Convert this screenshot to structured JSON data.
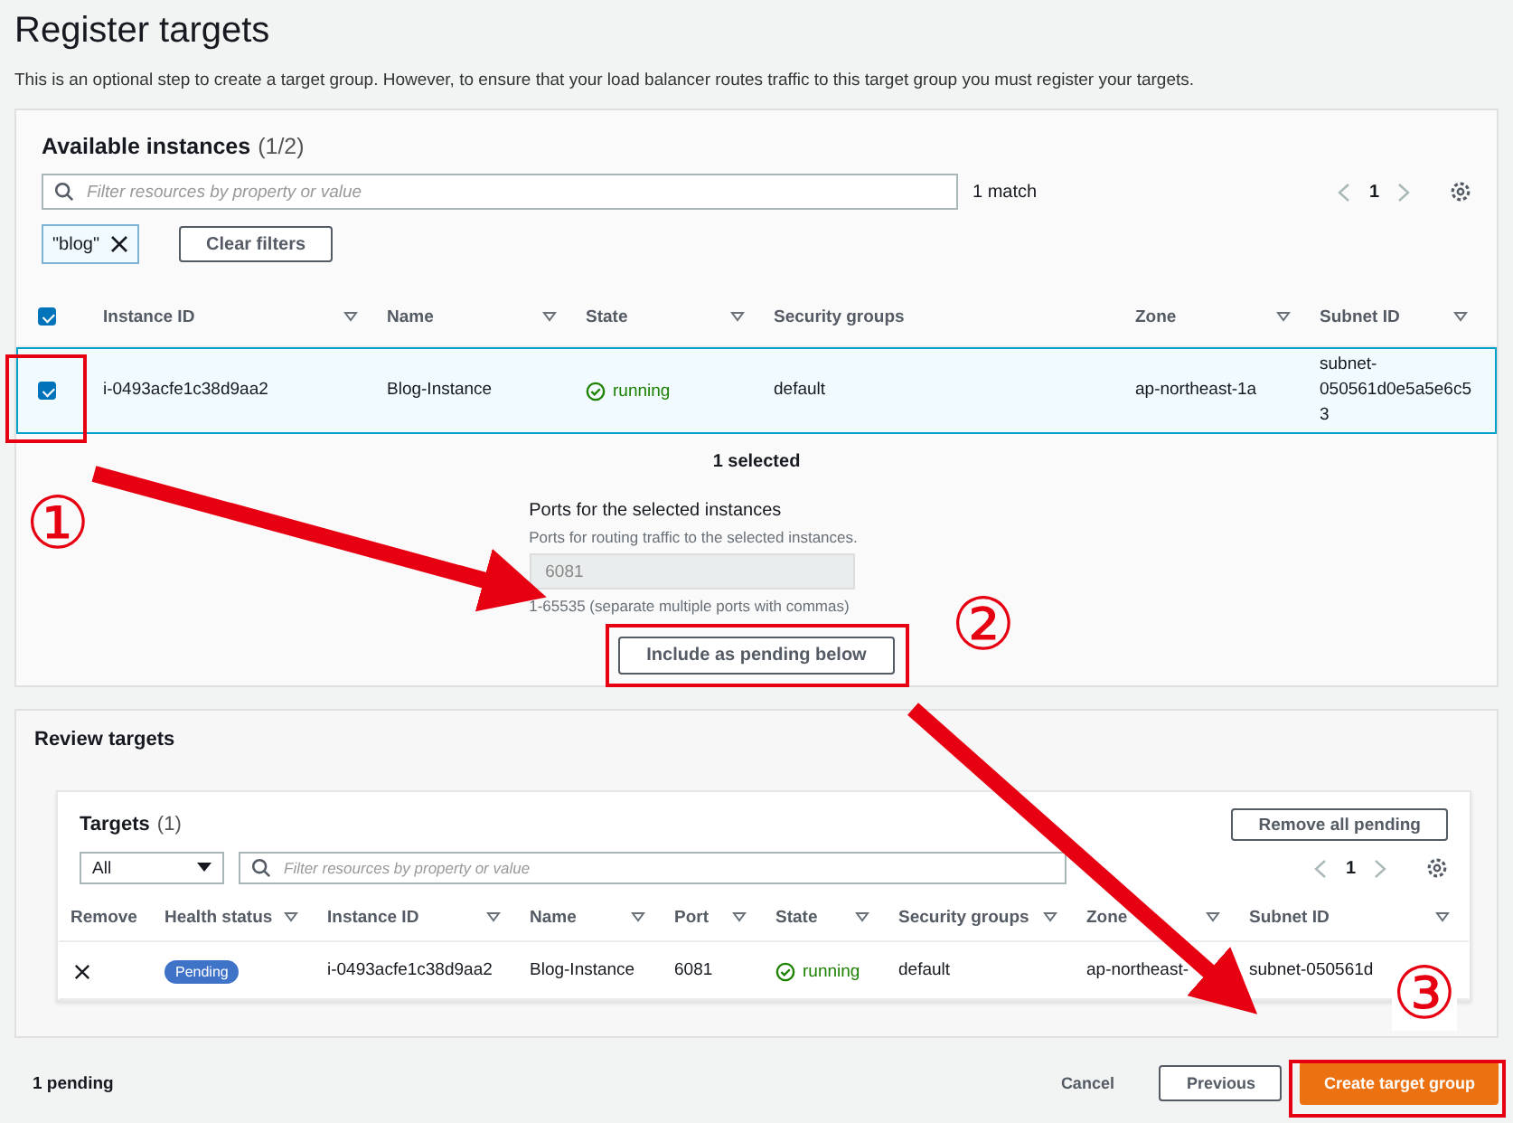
{
  "page": {
    "title": "Register targets",
    "description": "This is an optional step to create a target group. However, to ensure that your load balancer routes traffic to this target group you must register your targets."
  },
  "available": {
    "title": "Available instances",
    "count": "(1/2)",
    "search": {
      "placeholder": "Filter resources by property or value"
    },
    "match": "1 match",
    "page": "1",
    "filter_token": "\"blog\"",
    "clear_button": "Clear filters",
    "header_checked": true,
    "columns": [
      {
        "label": "Instance ID",
        "sortable": true
      },
      {
        "label": "Name",
        "sortable": true
      },
      {
        "label": "State",
        "sortable": true
      },
      {
        "label": "Security groups"
      },
      {
        "label": "Zone",
        "sortable": true
      },
      {
        "label": "Subnet ID",
        "sortable": true
      }
    ],
    "rows": [
      {
        "selected": true,
        "cells": [
          {
            "kind": "text",
            "text": "i-0493acfe1c38d9aa2"
          },
          {
            "kind": "text",
            "text": "Blog-Instance"
          },
          {
            "kind": "status",
            "text": "running"
          },
          {
            "kind": "text",
            "text": "default"
          },
          {
            "kind": "text",
            "text": "ap-northeast-1a"
          },
          {
            "kind": "text",
            "text": "subnet-050561d0e5a5e6c53"
          }
        ]
      }
    ],
    "selected_summary": "1 selected",
    "ports": {
      "label": "Ports for the selected instances",
      "hint": "Ports for routing traffic to the selected instances.",
      "value": "6081",
      "constraint": "1-65535 (separate multiple ports with commas)"
    },
    "include_button": "Include as pending below"
  },
  "review": {
    "title": "Review targets",
    "targets": {
      "title": "Targets",
      "count": "(1)",
      "remove_all_button": "Remove all pending",
      "filter_select": "All",
      "search": {
        "placeholder": "Filter resources by property or value"
      },
      "page": "1",
      "columns": [
        {
          "label": "Remove"
        },
        {
          "label": "Health status",
          "sortable": true
        },
        {
          "label": "Instance ID",
          "sortable": true
        },
        {
          "label": "Name",
          "sortable": true
        },
        {
          "label": "Port",
          "sortable": true
        },
        {
          "label": "State",
          "sortable": true
        },
        {
          "label": "Security groups",
          "sortable": true
        },
        {
          "label": "Zone",
          "sortable": true
        },
        {
          "label": "Subnet ID",
          "sortable": true
        }
      ],
      "rows": [
        {
          "cells": [
            {
              "kind": "remove"
            },
            {
              "kind": "badge",
              "text": "Pending"
            },
            {
              "kind": "text",
              "text": "i-0493acfe1c38d9aa2"
            },
            {
              "kind": "text",
              "text": "Blog-Instance"
            },
            {
              "kind": "text",
              "text": "6081"
            },
            {
              "kind": "status",
              "text": "running"
            },
            {
              "kind": "text",
              "text": "default"
            },
            {
              "kind": "text",
              "text": "ap-northeast-"
            },
            {
              "kind": "text",
              "text": "subnet-050561d"
            }
          ]
        }
      ]
    }
  },
  "footer": {
    "pending": "1 pending",
    "buttons": [
      {
        "kind": "link",
        "label": "Cancel"
      },
      {
        "kind": "secondary",
        "label": "Previous"
      },
      {
        "kind": "primary",
        "label": "Create target group"
      }
    ]
  },
  "annotations": [
    {
      "label": "①"
    },
    {
      "label": "②"
    },
    {
      "label": "③"
    }
  ]
}
